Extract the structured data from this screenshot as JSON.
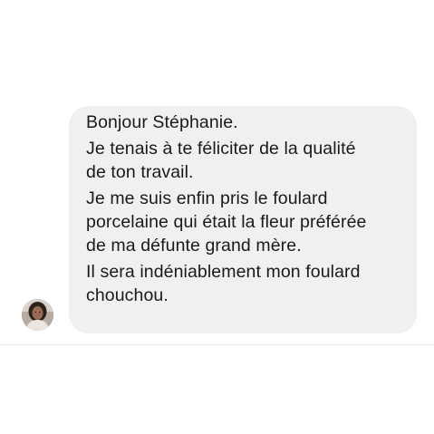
{
  "message": {
    "paragraphs": [
      [
        "Bonjour Stéphanie."
      ],
      [
        "Je tenais à te féliciter de la qualité",
        "de ton travail."
      ],
      [
        "Je me suis enfin pris le foulard",
        "porcelaine qui était la fleur préférée",
        "de ma défunte grand mère."
      ],
      [
        "Il sera indéniablement mon foulard",
        "chouchou."
      ]
    ]
  },
  "avatar": {
    "icon": "user-avatar-photo"
  },
  "colors": {
    "bubble_background": "#f0f0f2",
    "text": "#1a1a1a",
    "page_background": "#ffffff"
  }
}
